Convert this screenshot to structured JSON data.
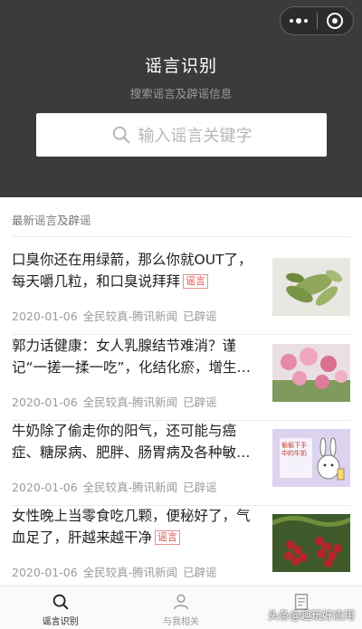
{
  "header": {
    "title": "谣言识别",
    "subtitle": "搜索谣言及辟谣信息",
    "capsule_more_icon": "more-dots-icon",
    "capsule_close_icon": "close-circle-icon"
  },
  "search": {
    "placeholder": "输入谣言关键字",
    "icon": "search-icon"
  },
  "section": {
    "title": "最新谣言及辟谣"
  },
  "articles": [
    {
      "title": "口臭你还在用绿箭，那么你就OUT了，每天嚼几粒，和口臭说拜拜",
      "tag": "谣言",
      "date": "2020-01-06",
      "source": "全民较真-腾讯新闻",
      "status": "已辟谣",
      "thumb_icon": "green-leaves-photo"
    },
    {
      "title": "郭力话健康：女人乳腺结节难消？谨记“一搓一揉一吃”，化结化瘀，增生…",
      "tag": "",
      "date": "2020-01-06",
      "source": "全民较真-腾讯新闻",
      "status": "已辟谣",
      "thumb_icon": "pink-flowers-photo"
    },
    {
      "title": "牛奶除了偷走你的阳气，还可能与癌症、糖尿病、肥胖、肠胃病及各种敏…",
      "tag": "",
      "date": "2020-01-06",
      "source": "全民较真-腾讯新闻",
      "status": "已辟谣",
      "thumb_icon": "rabbit-cartoon-illustration",
      "thumb_caption": "偷偷下手中的牛奶"
    },
    {
      "title": "女性晚上当零食吃几颗，便秘好了，气血足了，肝越来越干净",
      "tag": "谣言",
      "date": "2020-01-06",
      "source": "全民较真-腾讯新闻",
      "status": "已辟谣",
      "thumb_icon": "red-dates-photo"
    }
  ],
  "tabbar": {
    "tabs": [
      {
        "label": "谣言识别",
        "icon": "search-icon",
        "active": true
      },
      {
        "label": "与我相关",
        "icon": "person-icon",
        "active": false
      },
      {
        "label": "",
        "icon": "document-icon",
        "active": false
      }
    ]
  },
  "watermark": "头条@趣玩好应用",
  "colors": {
    "header_bg": "#3b3b3b",
    "tag_red": "#d9534f",
    "meta_gray": "#9b9b9b"
  }
}
